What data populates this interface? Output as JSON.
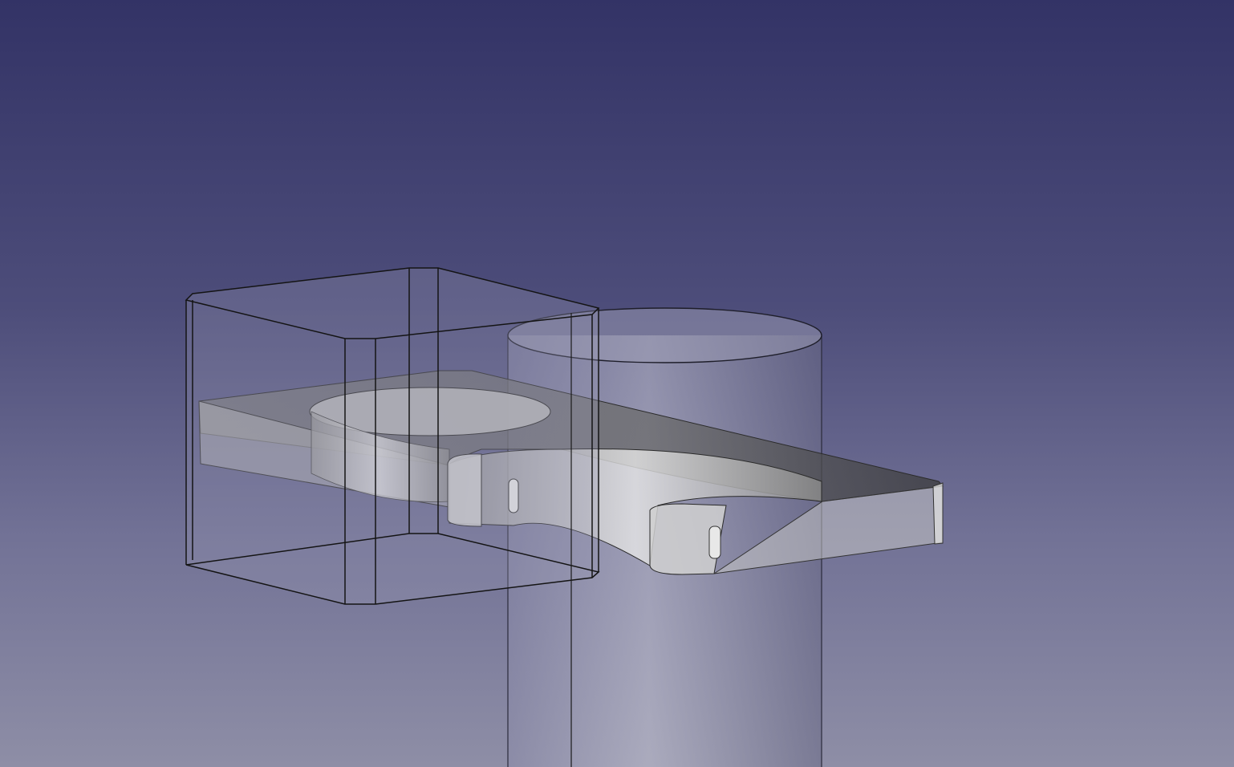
{
  "viewer": {
    "background": {
      "top_color": "#333366",
      "bottom_color": "#8e8ea6"
    },
    "objects": [
      {
        "name": "box",
        "display_mode": "transparent",
        "edge_color": "#1a1a1a"
      },
      {
        "name": "cylinder",
        "display_mode": "transparent",
        "edge_color": "#1a1a1a"
      },
      {
        "name": "clip-bracket",
        "display_mode": "transparent",
        "face_color": "#c8c8c8",
        "edge_color": "#2a2a2a"
      }
    ]
  }
}
